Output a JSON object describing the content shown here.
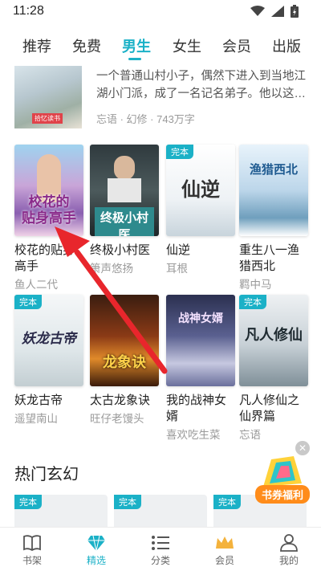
{
  "status": {
    "time": "11:28"
  },
  "tabs": [
    {
      "label": "推荐"
    },
    {
      "label": "免费"
    },
    {
      "label": "男生"
    },
    {
      "label": "女生"
    },
    {
      "label": "会员"
    },
    {
      "label": "出版"
    }
  ],
  "active_tab": "男生",
  "top_card": {
    "desc": "一个普通山村小子，偶然下进入到当地江湖小门派，成了一名记名弟子。他以这…",
    "meta": "忘语 · 幻修 · 743万字",
    "badge": "拾忆读书"
  },
  "books": [
    {
      "title": "校花的贴身高手",
      "author": "鱼人二代",
      "cover_text": "校花的\n贴身高手",
      "done": false
    },
    {
      "title": "终极小村医",
      "author": "箫声悠扬",
      "cover_text": "终极小村医",
      "done": false
    },
    {
      "title": "仙逆",
      "author": "耳根",
      "cover_text": "仙逆",
      "done": true
    },
    {
      "title": "重生八一渔猎西北",
      "author": "羁中马",
      "cover_text": "渔猎西北",
      "done": false
    },
    {
      "title": "妖龙古帝",
      "author": "遥望南山",
      "cover_text": "妖龙古帝",
      "done": true
    },
    {
      "title": "太古龙象诀",
      "author": "旺仔老馒头",
      "cover_text": "龙象诀",
      "done": false
    },
    {
      "title": "我的战神女婿",
      "author": "喜欢吃生菜",
      "cover_text": "战神女婿",
      "done": false
    },
    {
      "title": "凡人修仙之仙界篇",
      "author": "忘语",
      "cover_text": "凡人修仙",
      "done": true
    }
  ],
  "done_label": "完本",
  "section": {
    "title": "热门玄幻"
  },
  "promo": {
    "label": "书券福利"
  },
  "bottom_nav": [
    {
      "label": "书架",
      "icon": "book-icon"
    },
    {
      "label": "精选",
      "icon": "diamond-icon"
    },
    {
      "label": "分类",
      "icon": "list-icon"
    },
    {
      "label": "会员",
      "icon": "crown-icon"
    },
    {
      "label": "我的",
      "icon": "person-icon"
    }
  ],
  "colors": {
    "accent": "#1bb1c7",
    "arrow": "#e8262c"
  }
}
